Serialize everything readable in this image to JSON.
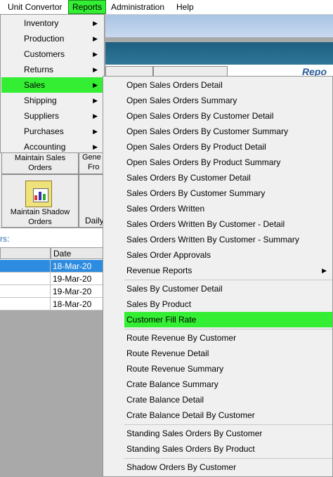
{
  "menubar": {
    "items": [
      "Unit Convertor",
      "Reports",
      "Administration",
      "Help"
    ],
    "active": "Reports"
  },
  "reports_menu": {
    "items": [
      "Inventory",
      "Production",
      "Customers",
      "Returns",
      "Sales",
      "Shipping",
      "Suppliers",
      "Purchases",
      "Accounting"
    ],
    "active": "Sales"
  },
  "sales_submenu": {
    "items": [
      "Open Sales Orders Detail",
      "Open Sales Orders Summary",
      "Open Sales Orders By Customer Detail",
      "Open Sales Orders By Customer Summary",
      "Open Sales Orders By Product Detail",
      "Open Sales Orders By Product Summary",
      "Sales Orders By Customer Detail",
      "Sales Orders By Customer Summary",
      "Sales Orders Written",
      "Sales Orders Written By Customer - Detail",
      "Sales Orders Written By Customer - Summary",
      "Sales Order Approvals",
      "Revenue Reports",
      "Sales By Customer Detail",
      "Sales By Product",
      "Customer Fill Rate",
      "Route Revenue By Customer",
      "Route Revenue Detail",
      "Route Revenue Summary",
      "Crate Balance Summary",
      "Crate Balance Detail",
      "Crate Balance Detail By Customer",
      "Standing Sales Orders By Customer",
      "Standing Sales Orders By Product",
      "Shadow Orders By Customer"
    ],
    "active": "Customer Fill Rate",
    "has_submenu": "Revenue Reports"
  },
  "background": {
    "header_partial": "Repo",
    "tiles": {
      "maintain_sales_orders": "Maintain Sales Orders",
      "gen_partial": "Gene",
      "from_partial": "Fro",
      "maintain_shadow_orders": "Maintain Shadow Orders",
      "daily_partial": "Daily"
    },
    "list_label_partial": "rs:",
    "date_header": "Date",
    "dates": [
      "18-Mar-20",
      "19-Mar-20",
      "19-Mar-20",
      "18-Mar-20"
    ]
  },
  "colors": {
    "highlight": "#33ee33",
    "selection": "#2e8ce0",
    "dark_bar": "#1f5f80"
  }
}
